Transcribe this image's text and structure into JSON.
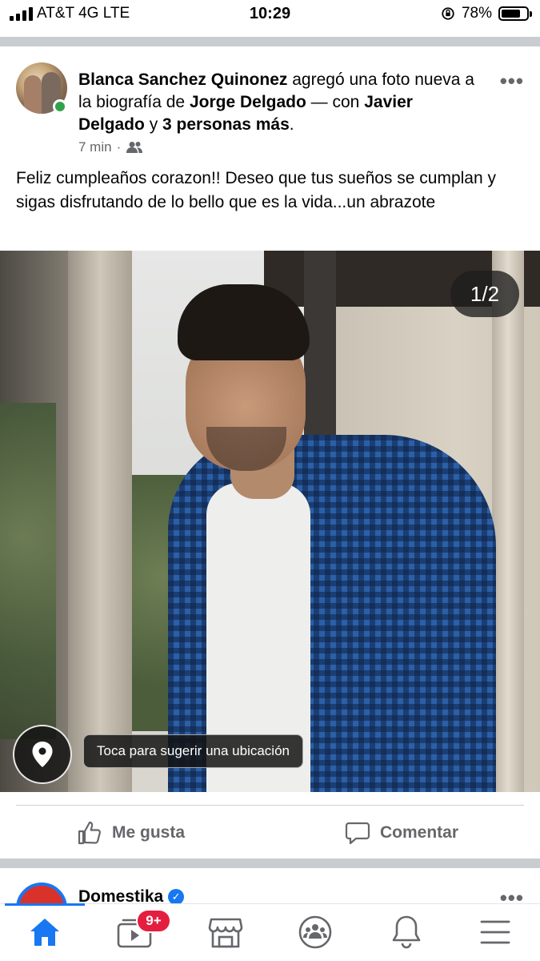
{
  "status_bar": {
    "carrier": "AT&T 4G  LTE",
    "time": "10:29",
    "battery_percent": "78%",
    "battery_level": 0.78
  },
  "post": {
    "author": "Blanca Sanchez Quinonez",
    "action_text": "agregó una foto nueva a la biografía de",
    "target": "Jorge Delgado",
    "with_text": "— con",
    "tagged": "Javier Delgado",
    "and_text": "y",
    "others": "3 personas más",
    "period": ".",
    "time_ago": "7 min",
    "dot": "·",
    "audience_icon": "friends-icon",
    "more_icon": "more-options-icon",
    "text": "Feliz cumpleaños corazon!! Deseo que tus sueños se cumplan y sigas disfrutando de lo bello que es la vida...un abrazote",
    "photo_counter": "1/2",
    "location_tip": "Toca para sugerir una ubicación",
    "actions": {
      "like": "Me gusta",
      "comment": "Comentar"
    }
  },
  "next_post": {
    "author": "Domestika"
  },
  "tab_bar": {
    "items": [
      "home-icon",
      "video-icon",
      "marketplace-icon",
      "groups-icon",
      "notifications-icon",
      "menu-icon"
    ],
    "video_badge": "9+",
    "active": "home-icon"
  },
  "colors": {
    "accent": "#1877f2",
    "online": "#31a24c",
    "badge": "#e41e3f",
    "secondary_text": "#65676b"
  }
}
